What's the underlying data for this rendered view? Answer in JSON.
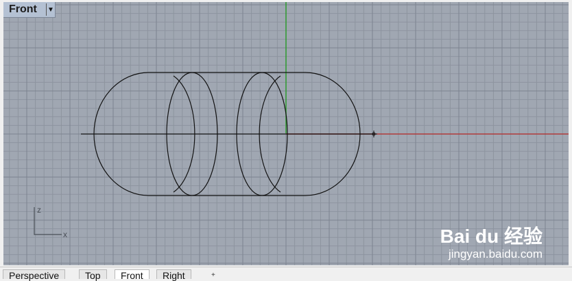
{
  "viewport": {
    "title": "Front",
    "menu_icon": "dropdown-arrow",
    "axis_labels": {
      "z": "z",
      "x": "x"
    },
    "colors": {
      "background": "#a0a7b2",
      "x_axis": "#b03a3a",
      "y_axis": "#2e9a2e",
      "curves": "#111111"
    }
  },
  "watermark": {
    "logo_text": "Bai du 经验",
    "url": "jingyan.baidu.com"
  },
  "tabs": [
    {
      "label": "Perspective"
    },
    {
      "label": "Top"
    },
    {
      "label": "Front",
      "active": true
    },
    {
      "label": "Right"
    }
  ],
  "tab_add_icon": "plus-icon"
}
